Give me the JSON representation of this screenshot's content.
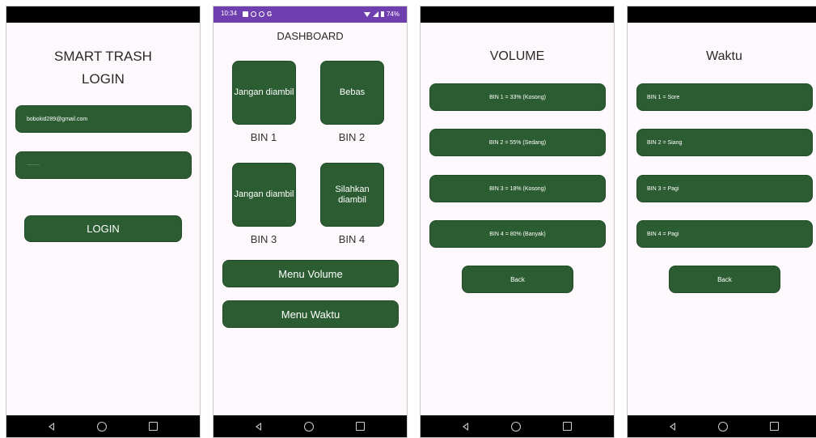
{
  "colors": {
    "button_green": "#2b5c32",
    "status_bar": "#6f3fb0",
    "screen_bg": "#fcf8fc"
  },
  "login": {
    "title_line1": "SMART TRASH",
    "title_line2": "LOGIN",
    "email_value": "bobokid289@gmail.com",
    "password_value": "········",
    "login_label": "LOGIN"
  },
  "dashboard": {
    "status_time": "10:34",
    "status_g": "G",
    "status_battery": "74%",
    "title": "DASHBOARD",
    "bins": [
      {
        "status": "Jangan diambil",
        "label": "BIN 1"
      },
      {
        "status": "Bebas",
        "label": "BIN 2"
      },
      {
        "status": "Jangan diambil",
        "label": "BIN 3"
      },
      {
        "status": "Silahkan diambil",
        "label": "BIN 4"
      }
    ],
    "menu_volume": "Menu Volume",
    "menu_waktu": "Menu Waktu"
  },
  "volume": {
    "title": "VOLUME",
    "rows": [
      "BIN 1 = 33% (Kosong)",
      "BIN 2 = 55% (Sedang)",
      "BIN 3 = 18% (Kosong)",
      "BIN 4 = 80% (Banyak)"
    ],
    "back": "Back"
  },
  "waktu": {
    "title": "Waktu",
    "rows": [
      "BIN 1 = Sore",
      "BIN 2 = Siang",
      "BIN 3 = Pagi",
      "BIN 4 = Pagi"
    ],
    "back": "Back"
  },
  "icons": [
    "back-nav-icon",
    "home-nav-icon",
    "recent-apps-icon",
    "wifi-icon",
    "signal-icon",
    "battery-icon"
  ]
}
